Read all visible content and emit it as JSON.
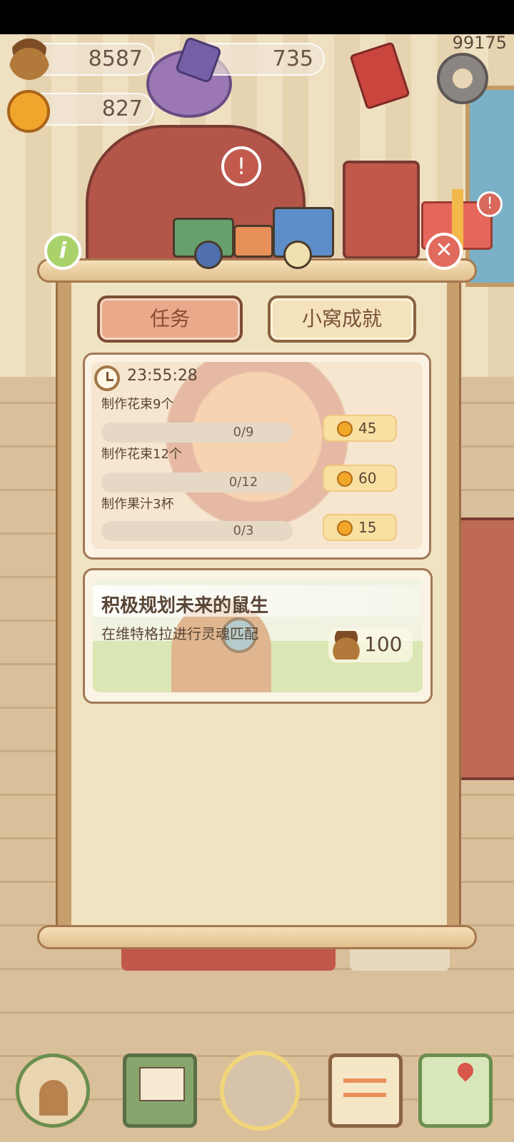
{
  "status": {
    "id_number": "99175"
  },
  "currency": {
    "acorns": "8587",
    "gems": "735",
    "bells": "827"
  },
  "tabs": [
    {
      "label": "任务",
      "active": true
    },
    {
      "label": "小窝成就",
      "active": false
    }
  ],
  "timer": "23:55:28",
  "tasks": [
    {
      "title": "制作花束9个",
      "progress": "0/9",
      "reward": "45"
    },
    {
      "title": "制作花束12个",
      "progress": "0/12",
      "reward": "60"
    },
    {
      "title": "制作果汁3杯",
      "progress": "0/3",
      "reward": "15"
    }
  ],
  "achievement": {
    "title": "积极规划未来的鼠生",
    "subtitle": "在维特格拉进行灵魂匹配",
    "reward": "100"
  },
  "icons": {
    "acorn": "acorn-icon",
    "gem": "purple-gem-icon",
    "bell": "gold-bell-icon",
    "settings": "gear-icon",
    "info": "info-icon",
    "close": "close-icon",
    "clock": "clock-icon",
    "nav": [
      "house-icon",
      "mail-icon",
      "collection-icon",
      "clipboard-icon",
      "map-icon"
    ]
  },
  "colors": {
    "active_tab": "#e9a98a",
    "inactive_tab": "#f4e2bd",
    "close_button": "#e06b5c",
    "info_button": "#a9d36a"
  }
}
